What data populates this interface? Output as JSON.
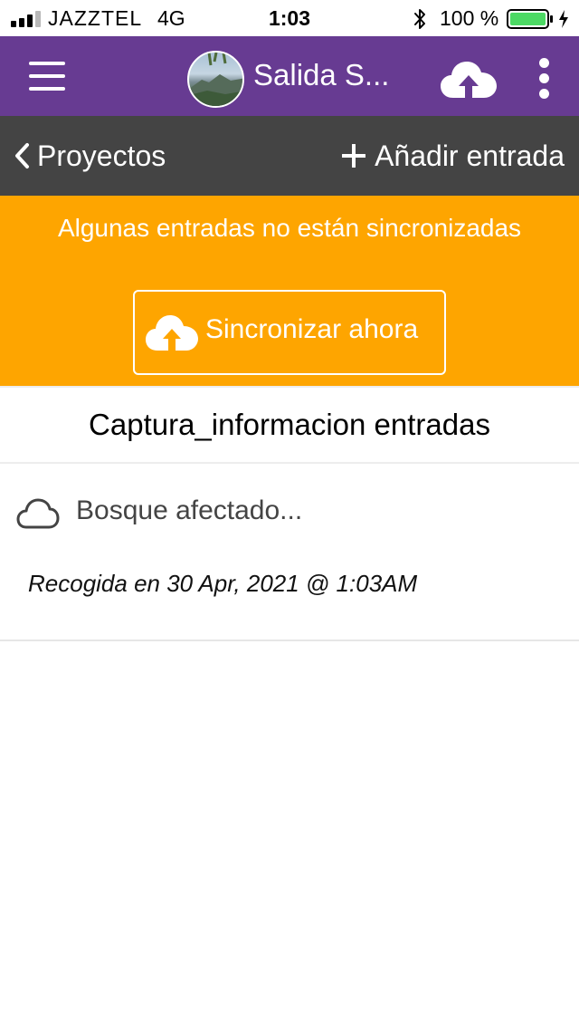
{
  "status_bar": {
    "carrier": "JAZZTEL",
    "network": "4G",
    "time": "1:03",
    "battery_percent": "100 %",
    "signal_bars_of_4": 3
  },
  "app_bar": {
    "title": "Salida S...",
    "menu_icon": "hamburger-icon",
    "upload_icon": "cloud-upload-icon",
    "more_icon": "more-vertical-icon"
  },
  "nav_bar": {
    "back_label": "Proyectos",
    "add_label": "Añadir entrada"
  },
  "sync_banner": {
    "message": "Algunas entradas no están sincronizadas",
    "button_label": "Sincronizar ahora"
  },
  "list": {
    "title": "Captura_informacion entradas",
    "entries": [
      {
        "title": "Bosque afectado...",
        "collected": "Recogida en 30 Apr, 2021 @ 1:03AM",
        "status_icon": "cloud-outline-icon"
      }
    ]
  },
  "colors": {
    "app_bar": "#673b92",
    "nav_bar": "#444444",
    "sync_banner": "#fea500",
    "battery": "#4cd964"
  }
}
